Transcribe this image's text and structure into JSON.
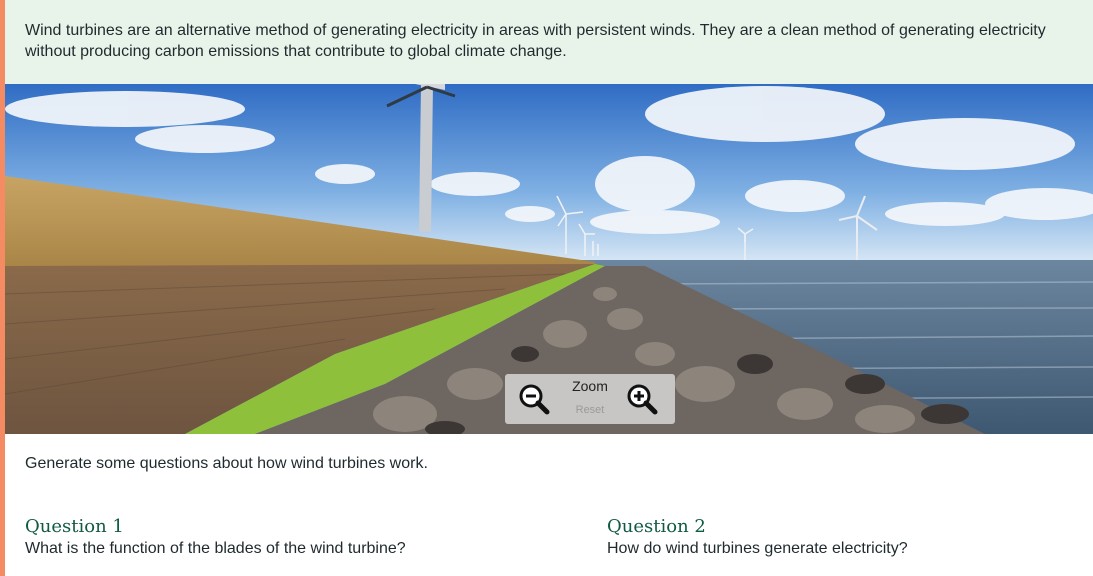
{
  "intro_text": "Wind turbines are an alternative method of generating electricity in areas with persistent winds. They are a clean method of generating electricity without producing carbon emissions that contribute to global climate change.",
  "image": {
    "zoom_label": "Zoom",
    "reset_label": "Reset",
    "zoom_out_icon": "zoom-out-icon",
    "zoom_in_icon": "zoom-in-icon"
  },
  "prompt": "Generate some questions about how wind turbines work.",
  "questions": [
    {
      "title": "Question 1",
      "text": "What is the function of the blades of the wind turbine?"
    },
    {
      "title": "Question 2",
      "text": "How do wind turbines generate electricity?"
    }
  ],
  "colors": {
    "accent": "#f58b63",
    "intro_background": "#e8f4ea",
    "question_title": "#0f5a44"
  }
}
